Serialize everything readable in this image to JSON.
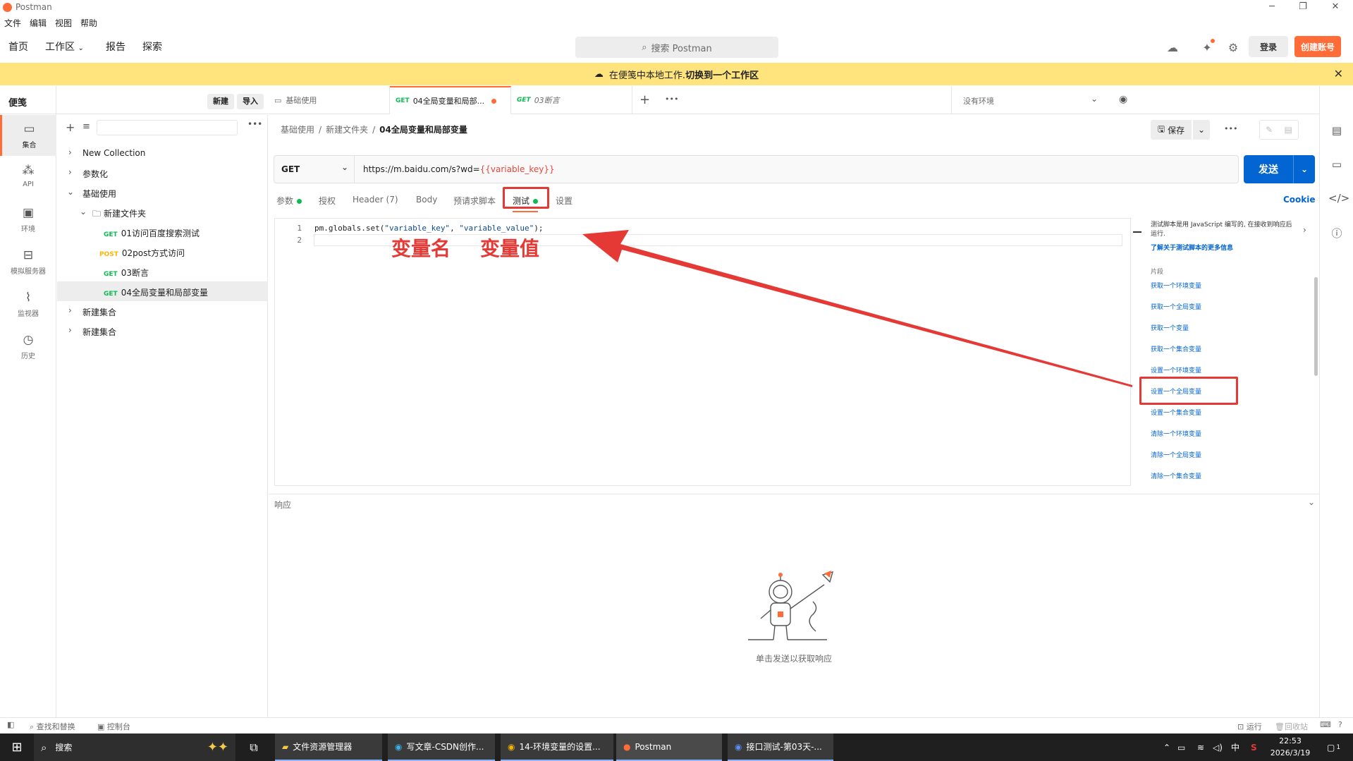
{
  "window": {
    "title": "Postman"
  },
  "menu": [
    "文件",
    "编辑",
    "视图",
    "帮助"
  ],
  "header": {
    "nav": [
      "首页",
      "工作区",
      "报告",
      "探索"
    ],
    "search_placeholder": "搜索 Postman",
    "login": "登录",
    "signup": "创建账号"
  },
  "banner": {
    "text": "在便笺中本地工作. ",
    "link": "切换到一个工作区"
  },
  "sidebar": {
    "title": "便笺",
    "new": "新建",
    "import": "导入",
    "rail": [
      "集合",
      "API",
      "环境",
      "模拟服务器",
      "监视器",
      "历史"
    ],
    "tree": [
      {
        "label": "New Collection"
      },
      {
        "label": "参数化"
      },
      {
        "label": "基础使用"
      },
      {
        "label": "新建文件夹"
      },
      {
        "method": "GET",
        "label": "01访问百度搜索测试"
      },
      {
        "method": "POST",
        "label": "02post方式访问"
      },
      {
        "method": "GET",
        "label": "03断言"
      },
      {
        "method": "GET",
        "label": "04全局变量和局部变量"
      },
      {
        "label": "新建集合"
      },
      {
        "label": "新建集合"
      }
    ]
  },
  "tabs": [
    {
      "label": "基础使用"
    },
    {
      "method": "GET",
      "label": "04全局变量和局部..."
    },
    {
      "method": "GET",
      "label": "03断言"
    }
  ],
  "environment": "没有环境",
  "breadcrumbs": [
    "基础使用",
    "新建文件夹",
    "04全局变量和局部变量"
  ],
  "save": "保存",
  "request": {
    "method": "GET",
    "url_prefix": "https://m.baidu.com/s?wd=",
    "url_var": "{{variable_key}}",
    "send": "发送",
    "tabs": [
      "参数",
      "授权",
      "Header (7)",
      "Body",
      "预请求脚本",
      "测试",
      "设置"
    ],
    "cookie": "Cookie"
  },
  "editor": {
    "line_numbers": [
      "1",
      "2"
    ],
    "code_prefix": "pm.globals.set(",
    "code_key": "\"variable_key\"",
    "code_sep": ", ",
    "code_value": "\"variable_value\"",
    "code_suffix": ");"
  },
  "annotations": {
    "name": "变量名",
    "value": "变量值"
  },
  "snippets": {
    "intro": "测试脚本是用 JavaScript 编写的, 在接收到响应后运行.",
    "learn_more": "了解关于测试脚本的更多信息",
    "heading": "片段",
    "items": [
      "获取一个环境变量",
      "获取一个全局变量",
      "获取一个变量",
      "获取一个集合变量",
      "设置一个环境变量",
      "设置一个全局变量",
      "设置一个集合变量",
      "清除一个环境变量",
      "清除一个全局变量",
      "清除一个集合变量"
    ]
  },
  "response": {
    "title": "响应",
    "empty_hint": "单击发送以获取响应"
  },
  "footer": {
    "find": "查找和替换",
    "console": "控制台",
    "run": "运行",
    "trash": "回收站"
  },
  "taskbar": {
    "search": "搜索",
    "apps": [
      "文件资源管理器",
      "写文章-CSDN创作...",
      "14-环境变量的设置...",
      "Postman",
      "接口测试-第03天-..."
    ],
    "ime": "中",
    "time": "22:53",
    "date": "2026/3/19",
    "notifications": "1"
  },
  "colors": {
    "accent": "#ff6c37",
    "send": "#0265d2",
    "banner": "#ffe47e",
    "annotation": "#e53935"
  }
}
